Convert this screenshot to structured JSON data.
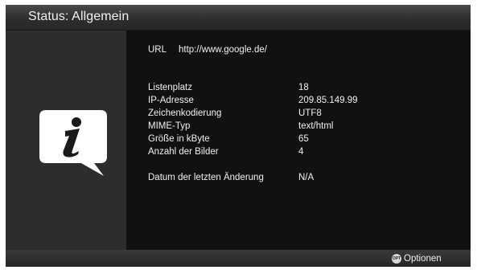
{
  "window": {
    "title": "Status: Allgemein"
  },
  "url": {
    "label": "URL",
    "value": "http://www.google.de/"
  },
  "details": [
    {
      "label": "Listenplatz",
      "value": "18"
    },
    {
      "label": "IP-Adresse",
      "value": "209.85.149.99"
    },
    {
      "label": "Zeichenkodierung",
      "value": "UTF8"
    },
    {
      "label": "MIME-Typ",
      "value": "text/html"
    },
    {
      "label": "Größe in kByte",
      "value": "65"
    },
    {
      "label": "Anzahl der Bilder",
      "value": "4"
    }
  ],
  "last_change": {
    "label": "Datum der letzten Änderung",
    "value": "N/A"
  },
  "footer": {
    "options_icon_text": "OPT",
    "options_label": "Optionen"
  },
  "icons": {
    "info": "info-icon",
    "options": "opt-button-icon"
  },
  "colors": {
    "background": "#121212",
    "side_panel": "#2d2d2d",
    "text": "#f0f0f0"
  }
}
